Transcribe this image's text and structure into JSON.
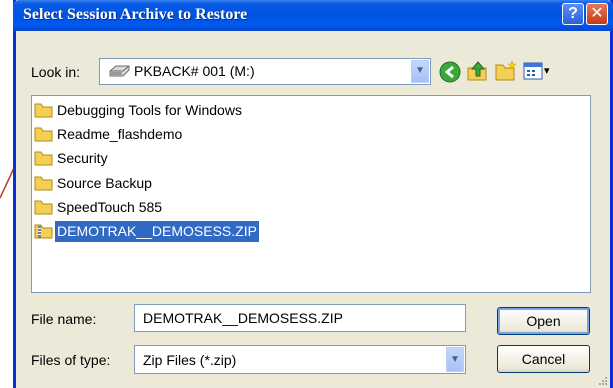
{
  "dialog": {
    "title": "Select Session Archive to Restore",
    "help_glyph": "?",
    "close_glyph": "✕"
  },
  "toolbar": {
    "look_in_label": "Look in:",
    "look_in_value": "PKBACK# 001 (M:)",
    "icons": [
      "drive-icon",
      "back-icon",
      "up-folder-icon",
      "new-folder-icon",
      "view-menu-icon"
    ],
    "view_menu_arrow": "▾"
  },
  "files": [
    {
      "name": "Debugging Tools for Windows",
      "type": "folder",
      "selected": false
    },
    {
      "name": "Readme_flashdemo",
      "type": "folder",
      "selected": false
    },
    {
      "name": "Security",
      "type": "folder",
      "selected": false
    },
    {
      "name": "Source Backup",
      "type": "folder",
      "selected": false
    },
    {
      "name": "SpeedTouch 585",
      "type": "folder",
      "selected": false
    },
    {
      "name": "DEMOTRAK__DEMOSESS.ZIP",
      "type": "zip",
      "selected": true
    }
  ],
  "filename": {
    "label": "File name:",
    "value": "DEMOTRAK__DEMOSESS.ZIP"
  },
  "filetype": {
    "label": "Files of type:",
    "value": "Zip Files (*.zip)"
  },
  "buttons": {
    "open": "Open",
    "cancel": "Cancel"
  },
  "colors": {
    "titlebar": "#0054e3",
    "selection": "#316ac5",
    "callout_line": "#c0392b"
  }
}
